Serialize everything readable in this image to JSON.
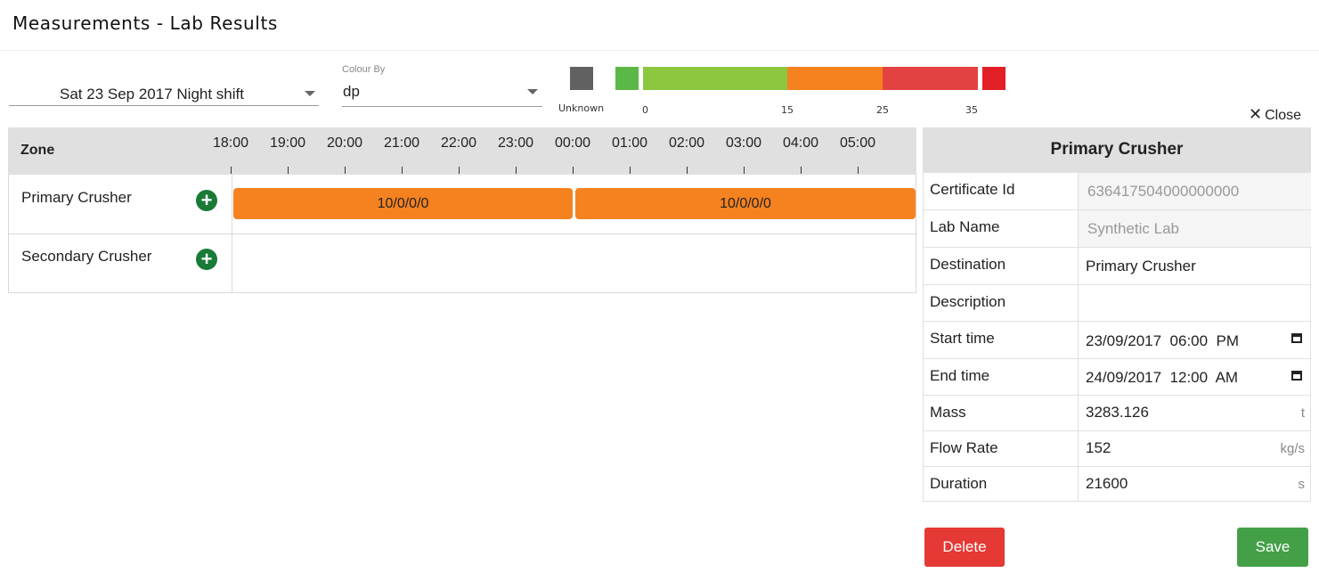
{
  "header": {
    "title": "Measurements - Lab Results"
  },
  "shift_select": {
    "value": "Sat 23 Sep 2017 Night shift"
  },
  "colour_by": {
    "label": "Colour By",
    "value": "dp"
  },
  "legend": {
    "unknown_label": "Unknown",
    "unknown_color": "#616161",
    "swatches": [
      "#5cb846",
      "#8dc63f",
      "#f5821f",
      "#e34242",
      "#e21f26"
    ],
    "ticks": [
      "0",
      "15",
      "25",
      "35"
    ]
  },
  "close_label": "Close",
  "timeline": {
    "zone_header": "Zone",
    "hours": [
      "18:00",
      "19:00",
      "20:00",
      "21:00",
      "22:00",
      "23:00",
      "00:00",
      "01:00",
      "02:00",
      "03:00",
      "04:00",
      "05:00"
    ],
    "rows": [
      {
        "name": "Primary Crusher",
        "bars": [
          "10/0/0/0",
          "10/0/0/0"
        ]
      },
      {
        "name": "Secondary Crusher",
        "bars": []
      }
    ],
    "bar_color": "#f5821f"
  },
  "detail": {
    "title": "Primary Crusher",
    "certificate_id": {
      "label": "Certificate Id",
      "value": "636417504000000000"
    },
    "lab_name": {
      "label": "Lab Name",
      "value": "Synthetic Lab"
    },
    "destination": {
      "label": "Destination",
      "value": "Primary Crusher"
    },
    "description": {
      "label": "Description",
      "value": ""
    },
    "start_time": {
      "label": "Start time",
      "value": "23/09/2017  06:00  PM"
    },
    "end_time": {
      "label": "End time",
      "value": "24/09/2017  12:00  AM"
    },
    "mass": {
      "label": "Mass",
      "value": "3283.126",
      "unit": "t"
    },
    "flow_rate": {
      "label": "Flow Rate",
      "value": "152",
      "unit": "kg/s"
    },
    "duration": {
      "label": "Duration",
      "value": "21600",
      "unit": "s"
    }
  },
  "buttons": {
    "delete": "Delete",
    "save": "Save"
  },
  "colors": {
    "delete": "#e53935",
    "save": "#43a047",
    "add": "#1a7a37"
  }
}
